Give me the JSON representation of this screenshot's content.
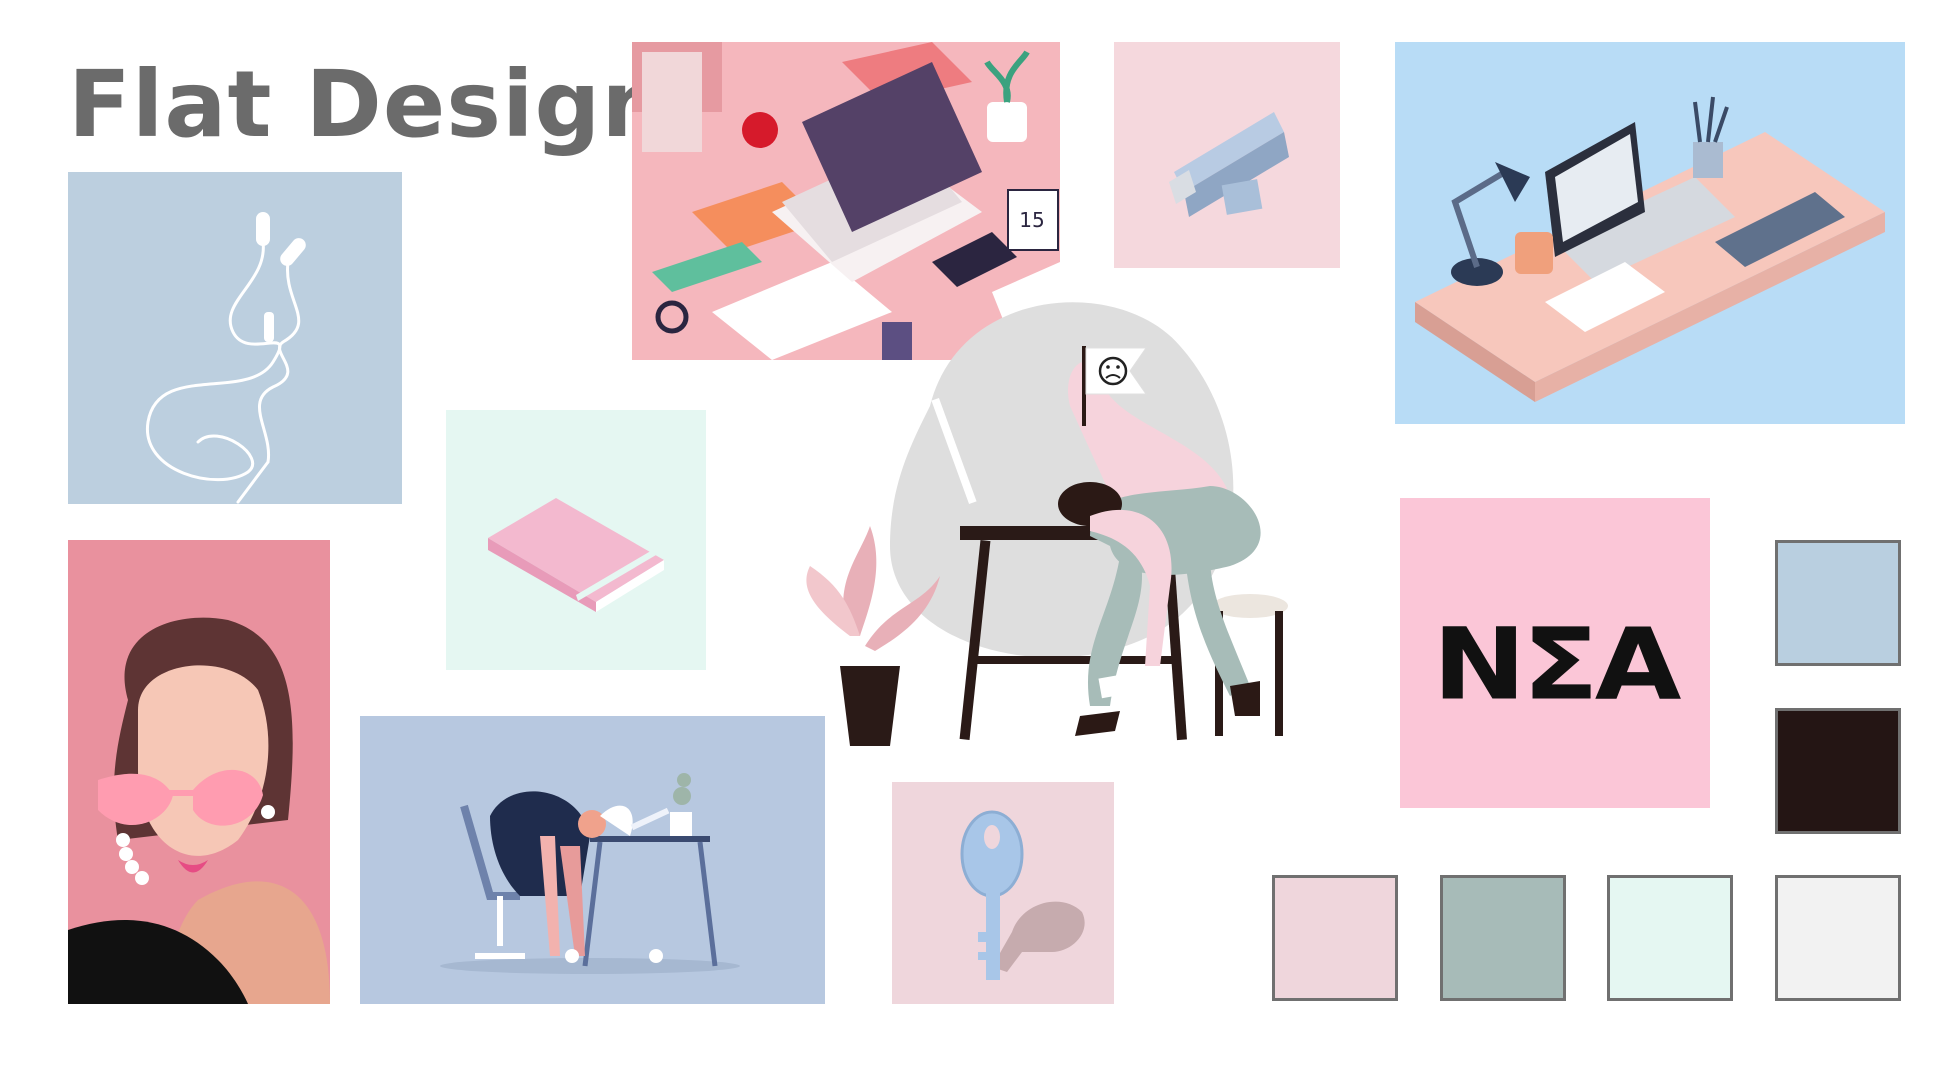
{
  "page": {
    "title": "Flat Design"
  },
  "logo": {
    "text": "NΣA"
  },
  "palette": {
    "colors": [
      "#b9cfe0",
      "#241514",
      "#efd6dc",
      "#a7bbb8",
      "#e5f7f2",
      "#f2f2f2"
    ]
  },
  "icons": {
    "earphones": "earphones-icon",
    "usb": "usb-drive-icon",
    "book": "book-icon",
    "key": "key-icon",
    "flag_face": "sad-face-icon"
  }
}
